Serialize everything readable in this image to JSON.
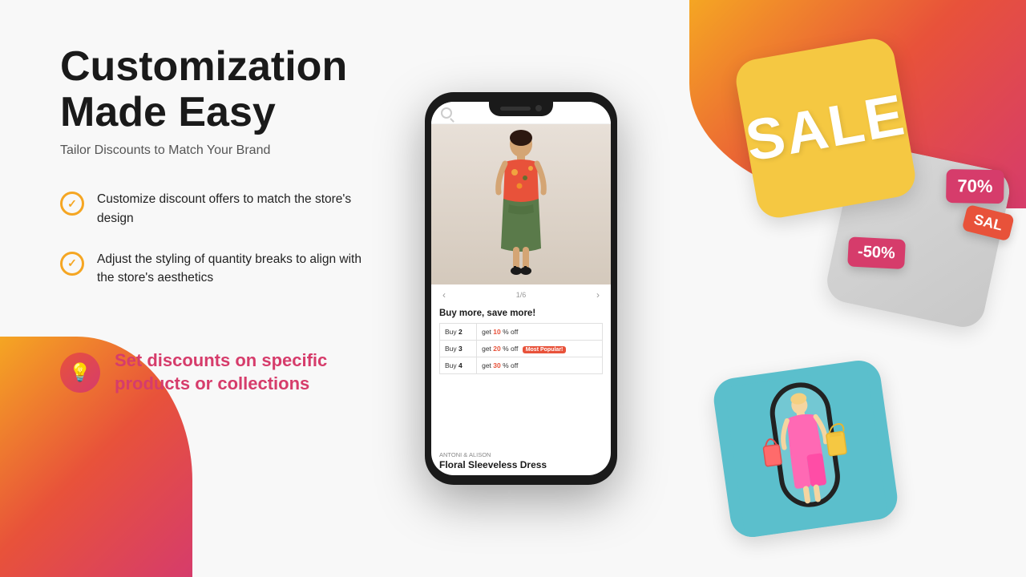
{
  "page": {
    "title": "Customization Made Easy",
    "subtitle": "Tailor Discounts to Match Your Brand"
  },
  "features": [
    {
      "id": "feature-1",
      "text": "Customize discount offers to match the store's design"
    },
    {
      "id": "feature-2",
      "text": "Adjust the styling of quantity breaks to align with the store's aesthetics"
    }
  ],
  "discount_feature": {
    "text": "Set discounts on specific products or collections"
  },
  "phone": {
    "buy_more_title": "Buy more, save more!",
    "nav_indicator": "1/6",
    "brand": "ANTONI & ALISON",
    "product_name": "Floral Sleeveless Dress",
    "rows": [
      {
        "buy": "Buy",
        "qty": "2",
        "get": "get",
        "pct": "10",
        "unit": "% off",
        "popular": false,
        "popular_label": ""
      },
      {
        "buy": "Buy",
        "qty": "3",
        "get": "get",
        "pct": "20",
        "unit": "% off",
        "popular": true,
        "popular_label": "Most Popular!"
      },
      {
        "buy": "Buy",
        "qty": "4",
        "get": "get",
        "pct": "30",
        "unit": "% off",
        "popular": false,
        "popular_label": ""
      }
    ]
  },
  "sale_cards": {
    "sale_text": "SALE",
    "tag_70": "70%",
    "tag_sale": "SAL",
    "tag_50": "-50%"
  },
  "colors": {
    "orange": "#f5a623",
    "red": "#e8523a",
    "pink": "#d63c6b",
    "yellow": "#f5c842",
    "teal": "#5bbfcc"
  }
}
